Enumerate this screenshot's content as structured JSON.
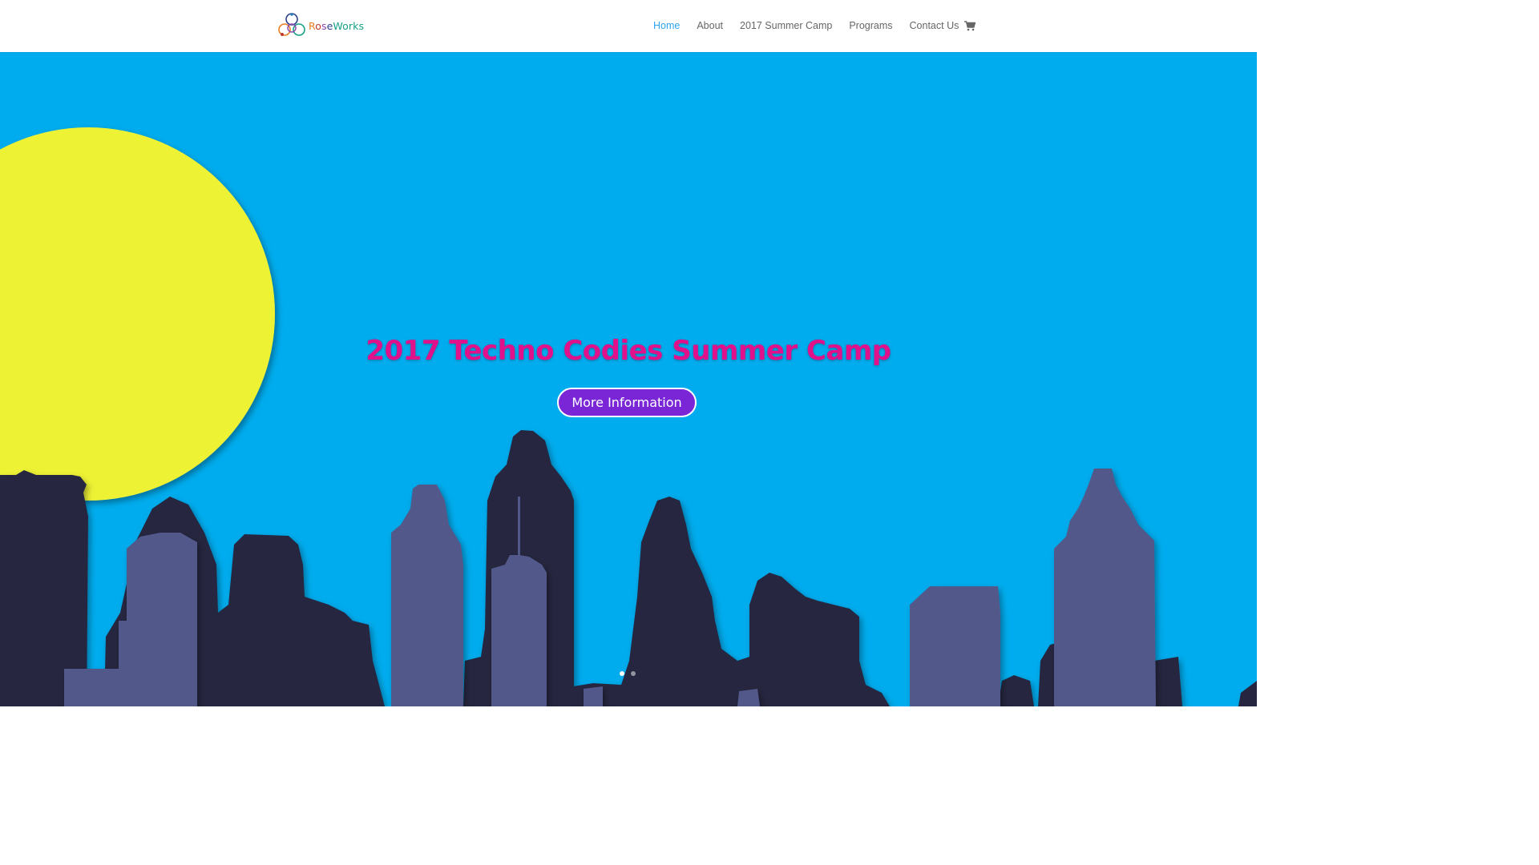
{
  "brand": {
    "name_parts": [
      "R",
      "o",
      "s",
      "e",
      "Works"
    ],
    "logo_icon": "roseworks-knot-logo"
  },
  "nav": {
    "items": [
      {
        "label": "Home",
        "active": true
      },
      {
        "label": "About",
        "active": false
      },
      {
        "label": "2017 Summer Camp",
        "active": false
      },
      {
        "label": "Programs",
        "active": false
      },
      {
        "label": "Contact Us",
        "active": false
      }
    ],
    "cart_icon": "shopping-cart-icon"
  },
  "hero": {
    "title": "2017 Techno Codies Summer Camp",
    "button_label": "More Information",
    "slides": 2,
    "active_slide": 1
  },
  "colors": {
    "accent": "#2ea3f2",
    "sky": "#00acee",
    "sun": "#eef234",
    "title": "#e0118b",
    "button": "#7a26d6",
    "building_dark": "#252840",
    "building_light": "#52598a"
  }
}
